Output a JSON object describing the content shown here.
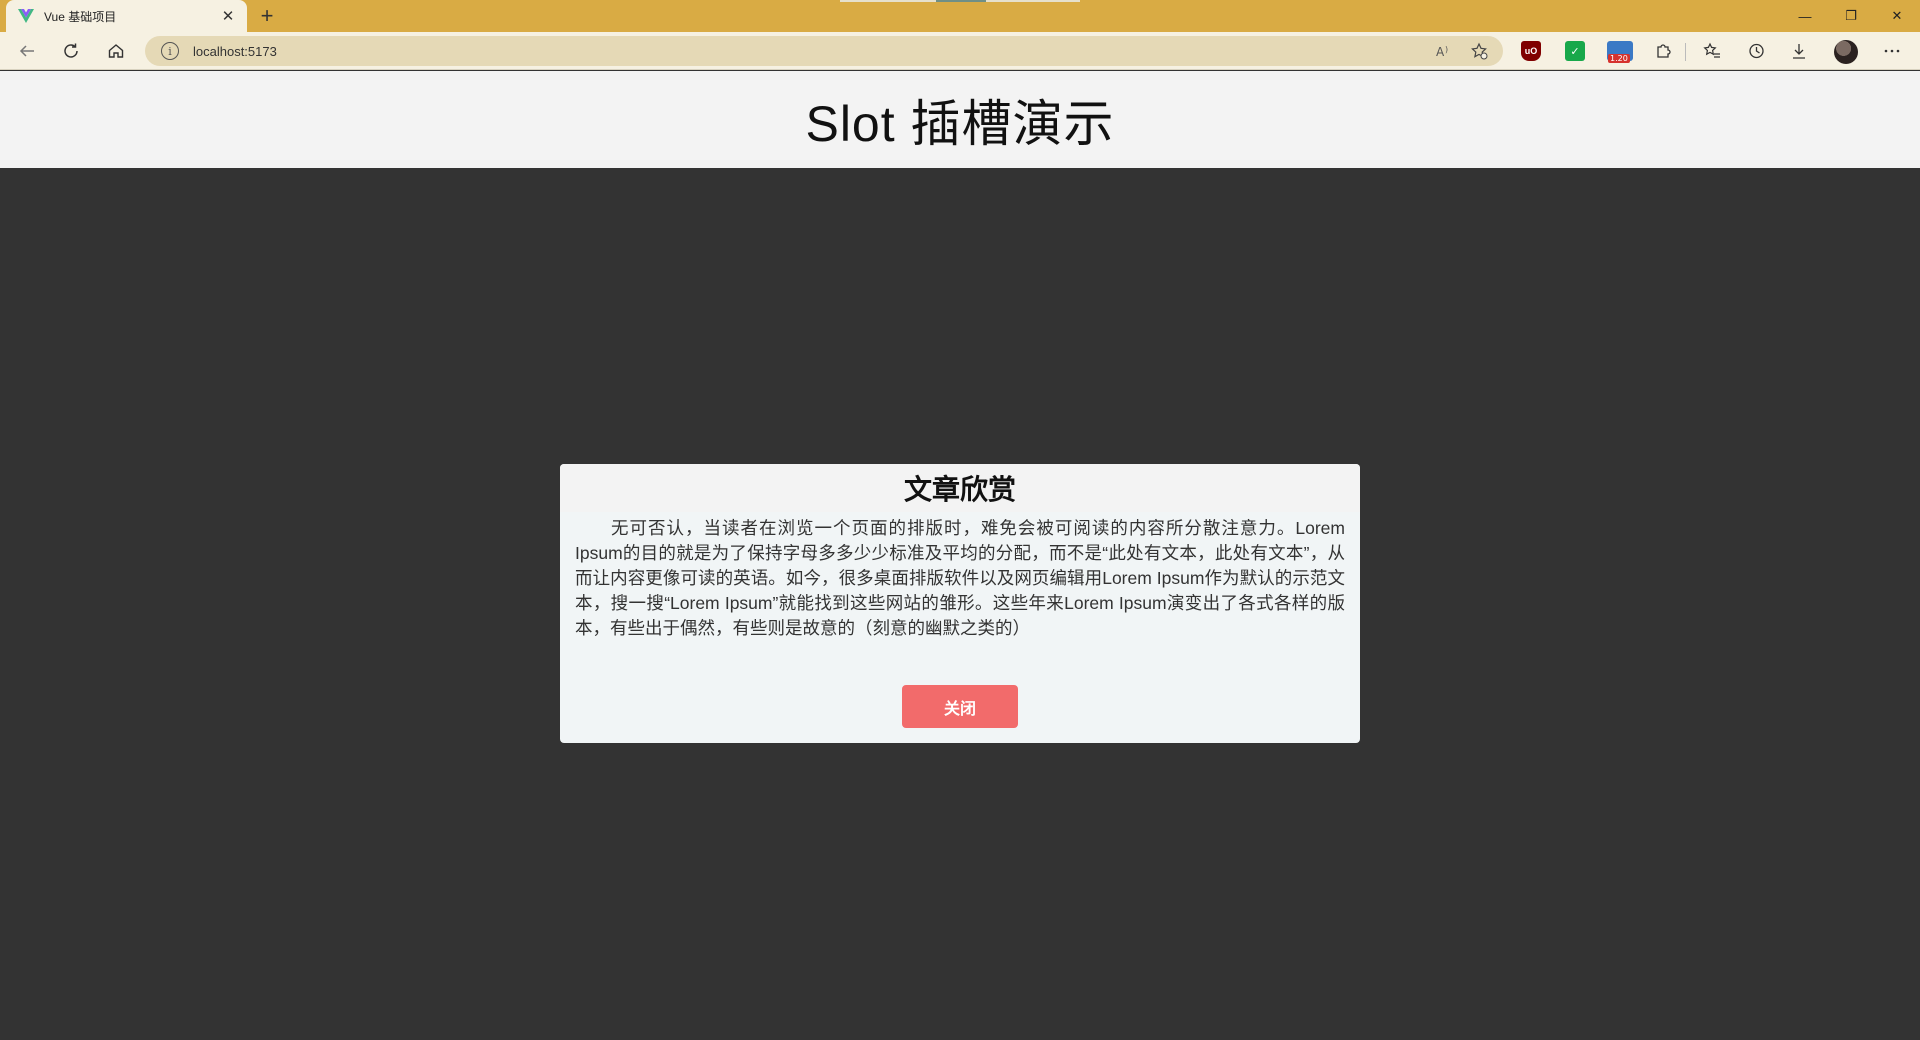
{
  "browser": {
    "tab": {
      "title": "Vue 基础项目",
      "favicon": "vue-logo-icon",
      "close_glyph": "✕"
    },
    "new_tab_glyph": "+",
    "window": {
      "minimize": "—",
      "restore": "❐",
      "close": "✕"
    },
    "address": {
      "url": "localhost:5173"
    },
    "extensions": {
      "badge_count": "1.20",
      "green_label": "✓",
      "ublock_label": "uO"
    }
  },
  "page": {
    "title": "Slot 插槽演示"
  },
  "modal": {
    "title": "文章欣赏",
    "body": "无可否认，当读者在浏览一个页面的排版时，难免会被可阅读的内容所分散注意力。Lorem Ipsum的目的就是为了保持字母多多少少标准及平均的分配，而不是“此处有文本，此处有文本”，从而让内容更像可读的英语。如今，很多桌面排版软件以及网页编辑用Lorem Ipsum作为默认的示范文本，搜一搜“Lorem Ipsum”就能找到这些网站的雏形。这些年来Lorem Ipsum演变出了各式各样的版本，有些出于偶然，有些则是故意的（刻意的幽默之类的）",
    "close_label": "关闭"
  },
  "colors": {
    "tabstrip": "#d9ab44",
    "toolbar": "#f6f1e2",
    "overlay": "#333333",
    "close_button": "#f26b6b"
  }
}
